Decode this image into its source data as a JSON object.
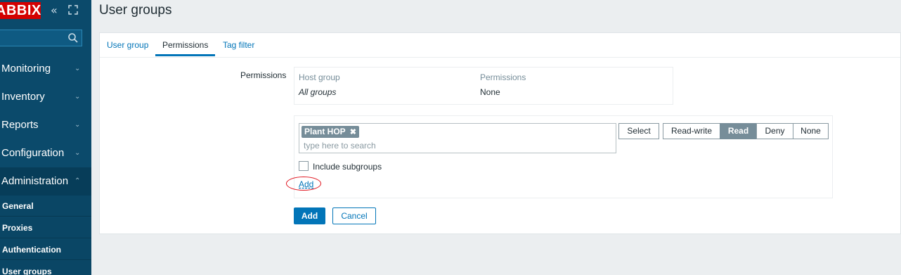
{
  "sidebar": {
    "logo": "ABBIX",
    "search": {
      "value": "",
      "icon": "search-icon"
    },
    "menu": [
      {
        "label": "Monitoring",
        "chevron": "⌄"
      },
      {
        "label": "Inventory",
        "chevron": "⌄"
      },
      {
        "label": "Reports",
        "chevron": "⌄"
      },
      {
        "label": "Configuration",
        "chevron": "⌄"
      },
      {
        "label": "Administration",
        "chevron": "⌃"
      }
    ],
    "submenu": [
      "General",
      "Proxies",
      "Authentication",
      "User groups"
    ]
  },
  "header": {
    "title": "User groups"
  },
  "tabs": [
    {
      "label": "User group"
    },
    {
      "label": "Permissions"
    },
    {
      "label": "Tag filter"
    }
  ],
  "permissions": {
    "label": "Permissions",
    "table": {
      "headers": [
        "Host group",
        "Permissions"
      ],
      "rows": [
        {
          "group": "All groups",
          "permission": "None"
        }
      ]
    },
    "editor": {
      "chip": "Plant HOP",
      "chip_remove": "✖",
      "placeholder": "type here to search",
      "select_label": "Select",
      "levels": [
        "Read-write",
        "Read",
        "Deny",
        "None"
      ],
      "selected_level": "Read",
      "include_subgroups": "Include subgroups",
      "add_link": "Add"
    }
  },
  "actions": {
    "add": "Add",
    "cancel": "Cancel"
  },
  "colors": {
    "sidebar": "#0b4a6b",
    "accent": "#0275b8",
    "logo": "#d40000",
    "annotation": "#e0141e"
  }
}
